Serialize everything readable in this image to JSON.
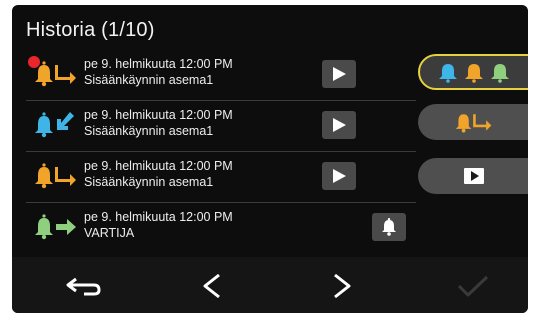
{
  "header": {
    "title": "Historia (1/10)"
  },
  "events": [
    {
      "date": "pe 9. helmikuuta 12:00 PM",
      "source": "Sisäänkäynnin asema1",
      "type": "missed-call-icon",
      "unread": true,
      "action": "play"
    },
    {
      "date": "pe 9. helmikuuta 12:00 PM",
      "source": "Sisäänkäynnin asema1",
      "type": "incoming-call-icon",
      "unread": false,
      "action": "play"
    },
    {
      "date": "pe 9. helmikuuta 12:00 PM",
      "source": "Sisäänkäynnin asema1",
      "type": "missed-call-icon",
      "unread": false,
      "action": "play"
    },
    {
      "date": "pe 9. helmikuuta 12:00 PM",
      "source": "VARTIJA",
      "type": "outgoing-call-icon",
      "unread": false,
      "action": "bell"
    }
  ],
  "filters": [
    {
      "name": "all-calls",
      "active": true
    },
    {
      "name": "missed-calls",
      "active": false
    },
    {
      "name": "recorded",
      "active": false
    }
  ],
  "colors": {
    "missed": "#f0a52a",
    "incoming": "#3fb4e6",
    "outgoing": "#8fd07f",
    "selected_border": "#e6d23a",
    "unread": "#e8262b"
  },
  "bottom_nav": [
    "back-icon",
    "prev-icon",
    "next-icon",
    "confirm-icon"
  ]
}
